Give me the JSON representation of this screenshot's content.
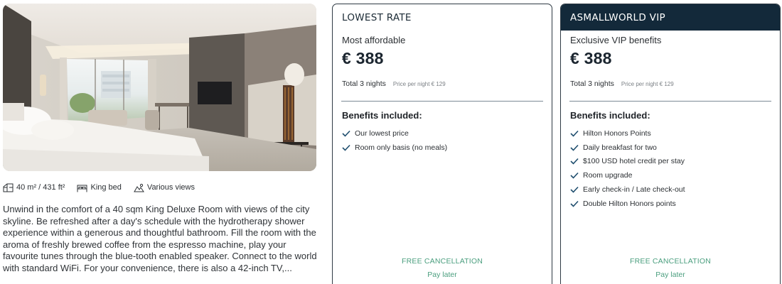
{
  "room": {
    "features": {
      "size": "40 m² / 431 ft²",
      "bed": "King bed",
      "view": "Various views"
    },
    "description": "Unwind in the comfort of a 40 sqm King Deluxe Room with views of the city skyline. Be refreshed after a day's schedule with the hydrotherapy shower experience within a generous and thoughtful bathroom. Fill the room with the aroma of freshly brewed coffee from the espresso machine, play your favourite tunes through the blue-tooth enabled speaker. Connect to the world with standard WiFi. For your convenience, there is also a 42-inch TV,..."
  },
  "rates": [
    {
      "title": "LOWEST RATE",
      "subtitle": "Most affordable",
      "price": "€ 388",
      "total_label": "Total 3 nights",
      "per_night": "Price per night € 129",
      "benefits_title": "Benefits included:",
      "benefits": [
        "Our lowest price",
        "Room only basis (no meals)"
      ],
      "cancellation": "FREE CANCELLATION",
      "payment": "Pay later"
    },
    {
      "title": "ASMALLWORLD VIP",
      "subtitle": "Exclusive VIP benefits",
      "price": "€ 388",
      "total_label": "Total 3 nights",
      "per_night": "Price per night € 129",
      "benefits_title": "Benefits included:",
      "benefits": [
        "Hilton Honors Points",
        "Daily breakfast for two",
        "$100 USD hotel credit per stay",
        "Room upgrade",
        "Early check-in / Late check-out",
        "Double Hilton Honors points"
      ],
      "cancellation": "FREE CANCELLATION",
      "payment": "Pay later"
    }
  ],
  "icons": {
    "size": "floor-plan-icon",
    "bed": "bed-icon",
    "view": "landscape-icon",
    "benefit": "check-icon"
  },
  "colors": {
    "vip_header_bg": "#13293a",
    "card_border": "#2f3a44",
    "accent_green": "#4a9e7e",
    "check_blue": "#1f4e6e"
  }
}
